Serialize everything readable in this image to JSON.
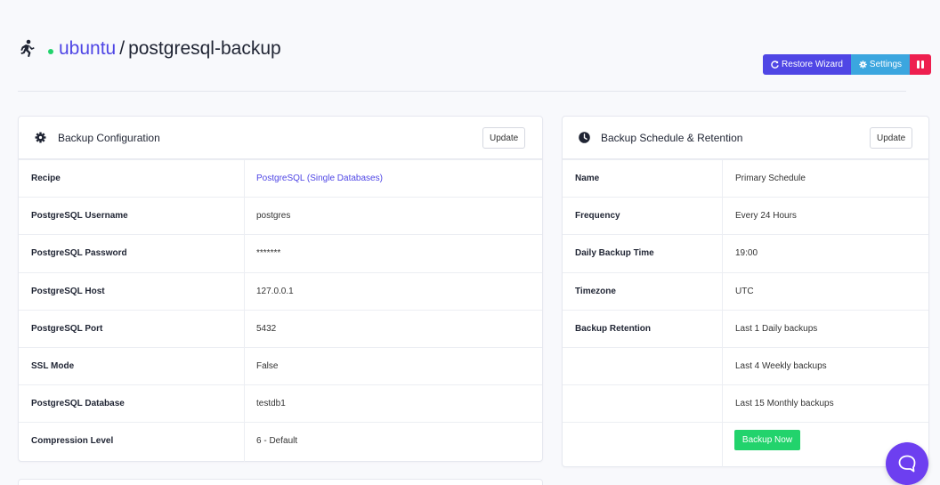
{
  "header": {
    "host": "ubuntu",
    "separator": "/",
    "name": "postgresql-backup",
    "status_color": "#22d36c",
    "icon": "runner-icon"
  },
  "actions": {
    "restore_label": "Restore Wizard",
    "settings_label": "Settings",
    "pause_icon": "pause-icon"
  },
  "backup_config": {
    "title": "Backup Configuration",
    "icon": "gear-icon",
    "update_label": "Update",
    "rows": [
      {
        "key": "Recipe",
        "value": "PostgreSQL (Single Databases)",
        "link": true
      },
      {
        "key": "PostgreSQL Username",
        "value": "postgres"
      },
      {
        "key": "PostgreSQL Password",
        "value": "*******"
      },
      {
        "key": "PostgreSQL Host",
        "value": "127.0.0.1"
      },
      {
        "key": "PostgreSQL Port",
        "value": "5432"
      },
      {
        "key": "SSL Mode",
        "value": "False"
      },
      {
        "key": "PostgreSQL Database",
        "value": "testdb1"
      },
      {
        "key": "Compression Level",
        "value": "6 - Default"
      }
    ]
  },
  "schedule": {
    "title": "Backup Schedule & Retention",
    "icon": "clock-icon",
    "update_label": "Update",
    "rows": [
      {
        "key": "Name",
        "value": "Primary Schedule"
      },
      {
        "key": "Frequency",
        "value": "Every 24 Hours"
      },
      {
        "key": "Daily Backup Time",
        "value": "19:00"
      },
      {
        "key": "Timezone",
        "value": "UTC"
      },
      {
        "key": "Backup Retention",
        "value": "Last 1 Daily backups"
      },
      {
        "key": "",
        "value": "Last 4 Weekly backups"
      },
      {
        "key": "",
        "value": "Last 15 Monthly backups"
      }
    ],
    "backup_now_label": "Backup Now"
  },
  "colors": {
    "accent": "#4f46e5",
    "settings": "#3ba6df",
    "danger": "#ee1f4f",
    "success": "#22d36c",
    "chat": "#6d3ff0"
  },
  "chat_icon": "chat-bubble-icon"
}
